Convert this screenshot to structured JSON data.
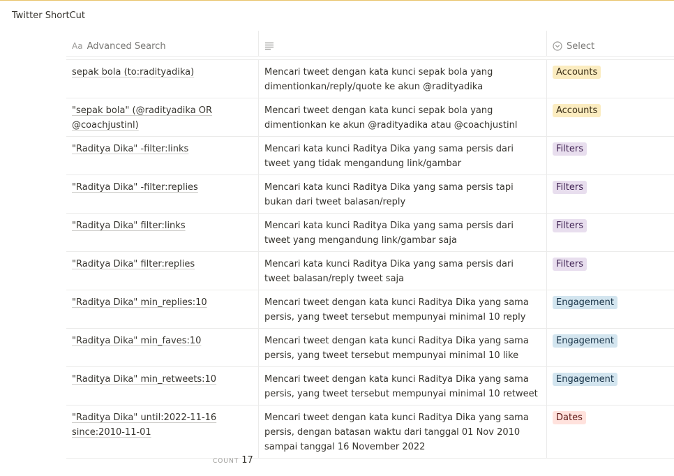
{
  "page": {
    "title": "Twitter ShortCut"
  },
  "columns": [
    {
      "label": "Advanced Search",
      "icon": "text-property-icon"
    },
    {
      "label": "",
      "icon": "text-lines-icon"
    },
    {
      "label": "Select",
      "icon": "select-property-icon"
    }
  ],
  "rows": [
    {
      "query": "sepak bola (to:radityadika)",
      "description": "Mencari tweet dengan kata kunci sepak bola yang dimentionkan/reply/quote ke akun @radityadika",
      "tag": "Accounts"
    },
    {
      "query": "\"sepak bola\" (@radityadika OR @coachjustinl)",
      "description": "Mencari tweet dengan kata kunci sepak bola yang dimentionkan ke akun @radityadika atau @coachjustinl",
      "tag": "Accounts"
    },
    {
      "query": "\"Raditya Dika\" -filter:links",
      "description": "Mencari kata kunci Raditya Dika yang sama persis dari tweet yang tidak mengandung link/gambar",
      "tag": "Filters"
    },
    {
      "query": "\"Raditya Dika\" -filter:replies",
      "description": "Mencari kata kunci Raditya Dika yang sama persis tapi bukan dari tweet balasan/reply",
      "tag": "Filters"
    },
    {
      "query": "\"Raditya Dika\" filter:links",
      "description": "Mencari kata kunci Raditya Dika yang sama persis dari tweet yang mengandung link/gambar saja",
      "tag": "Filters"
    },
    {
      "query": "\"Raditya Dika\" filter:replies",
      "description": "Mencari kata kunci Raditya Dika yang sama persis dari tweet balasan/reply tweet saja",
      "tag": "Filters"
    },
    {
      "query": "\"Raditya Dika\" min_replies:10",
      "description": "Mencari tweet dengan kata kunci Raditya Dika yang sama persis, yang tweet tersebut mempunyai minimal 10 reply",
      "tag": "Engagement"
    },
    {
      "query": "\"Raditya Dika\" min_faves:10",
      "description": "Mencari tweet dengan kata kunci Raditya Dika yang sama persis, yang tweet tersebut mempunyai minimal 10 like",
      "tag": "Engagement"
    },
    {
      "query": "\"Raditya Dika\" min_retweets:10",
      "description": "Mencari tweet dengan kata kunci Raditya Dika yang sama persis, yang tweet tersebut mempunyai minimal 10 retweet",
      "tag": "Engagement"
    },
    {
      "query": "\"Raditya Dika\" until:2022-11-16 since:2010-11-01",
      "description": "Mencari tweet dengan kata kunci Raditya Dika yang sama persis, dengan batasan waktu dari tanggal 01 Nov 2010 sampai tanggal 16 November 2022",
      "tag": "Dates"
    }
  ],
  "tag_colors": {
    "Accounts": "#fbecc0",
    "Filters": "#e8deee",
    "Engagement": "#d3e5ef",
    "Dates": "#ffe2dd"
  },
  "footer": {
    "count_label": "COUNT",
    "count_value": "17"
  }
}
